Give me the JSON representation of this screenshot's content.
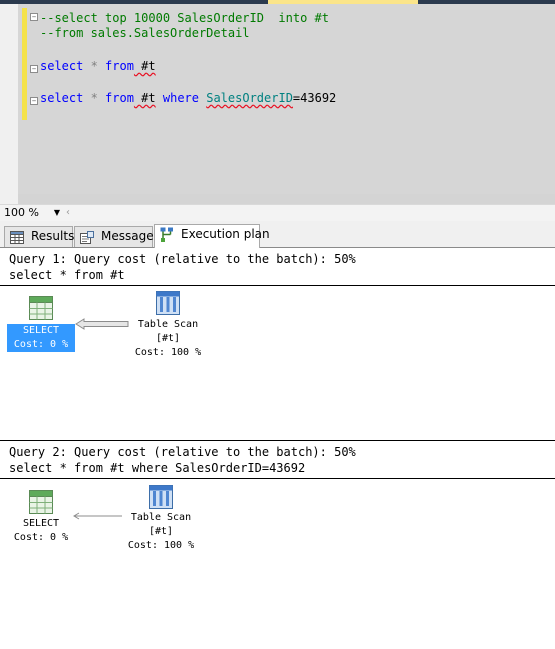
{
  "editor": {
    "lines": [
      {
        "parts": [
          {
            "t": "--select top 10000 SalesOrderID  into #t",
            "c": "c-comment"
          }
        ]
      },
      {
        "parts": [
          {
            "t": "--from sales.SalesOrderDetail",
            "c": "c-comment"
          }
        ]
      },
      {
        "parts": [
          {
            "t": "select",
            "c": "c-kw"
          },
          {
            "t": " * ",
            "c": "c-op"
          },
          {
            "t": "from",
            "c": "c-kw"
          },
          {
            "t": " #t",
            "c": "c-plain c-sq"
          }
        ]
      },
      {
        "parts": [
          {
            "t": "select",
            "c": "c-kw"
          },
          {
            "t": " * ",
            "c": "c-op"
          },
          {
            "t": "from",
            "c": "c-kw"
          },
          {
            "t": " #t",
            "c": "c-plain c-sq"
          },
          {
            "t": " where ",
            "c": "c-kw"
          },
          {
            "t": "SalesOrderID",
            "c": "c-ident"
          },
          {
            "t": "=43692",
            "c": "c-plain"
          }
        ]
      }
    ]
  },
  "zoom": {
    "value": "100 %"
  },
  "tabs": {
    "results": "Results",
    "messages": "Messages",
    "execution_plan": "Execution plan"
  },
  "queries": [
    {
      "header": "Query 1: Query cost (relative to the batch): 50%",
      "sql": "select * from #t",
      "select_label": "SELECT",
      "select_cost": "Cost: 0 %",
      "scan_label": "Table Scan",
      "scan_object": "[#t]",
      "scan_cost": "Cost: 100 %"
    },
    {
      "header": "Query 2: Query cost (relative to the batch): 50%",
      "sql": "select * from #t where SalesOrderID=43692",
      "select_label": "SELECT",
      "select_cost": "Cost: 0 %",
      "scan_label": "Table Scan",
      "scan_object": "[#t]",
      "scan_cost": "Cost: 100 %"
    }
  ],
  "colors": {
    "selection": "#3399ff",
    "editor_background": "#d6d6d6",
    "change_bar": "#f4e24a"
  }
}
